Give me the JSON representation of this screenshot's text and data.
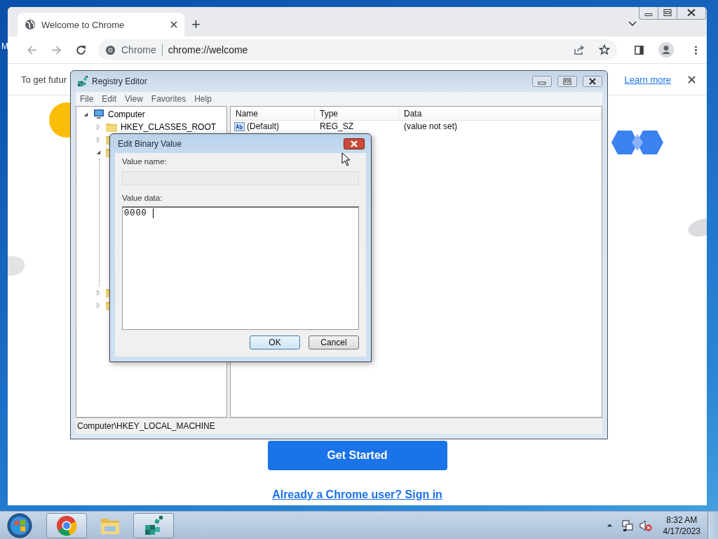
{
  "desktop": {
    "icon_label": "M"
  },
  "chrome": {
    "tab": {
      "title": "Welcome to Chrome",
      "selected": true
    },
    "new_tab": "+",
    "omnibox": {
      "site": "Chrome",
      "url": "chrome://welcome"
    },
    "infobar": {
      "text": "To get futur",
      "link": "Learn more"
    },
    "page": {
      "button": "Get Started",
      "link": "Already a Chrome user? Sign in"
    }
  },
  "regedit": {
    "title": "Registry Editor",
    "menu": [
      "File",
      "Edit",
      "View",
      "Favorites",
      "Help"
    ],
    "tree": {
      "label": "Computer",
      "expanded": true,
      "children": [
        {
          "label": "HKEY_CLASSES_ROOT",
          "expanded": false
        },
        {
          "expanded": false
        },
        {
          "expanded": true
        },
        {
          "expanded": false
        },
        {
          "expanded": false
        }
      ]
    },
    "columns": [
      "Name",
      "Type",
      "Data"
    ],
    "rows": [
      {
        "name": "(Default)",
        "type": "REG_SZ",
        "data": "(value not set)"
      }
    ],
    "status": "Computer\\HKEY_LOCAL_MACHINE"
  },
  "dialog": {
    "title": "Edit Binary Value",
    "name_label": "Value name:",
    "data_label": "Value data:",
    "data": "0000",
    "buttons": [
      {
        "label": "OK",
        "default": true
      },
      {
        "label": "Cancel",
        "default": false
      }
    ]
  },
  "taskbar": {
    "apps": [
      {
        "kind": "chrome",
        "open": true
      },
      {
        "kind": "explorer",
        "open": false
      },
      {
        "kind": "regedit",
        "open": true
      }
    ],
    "time": "8:32 AM",
    "date": "4/17/2023"
  }
}
